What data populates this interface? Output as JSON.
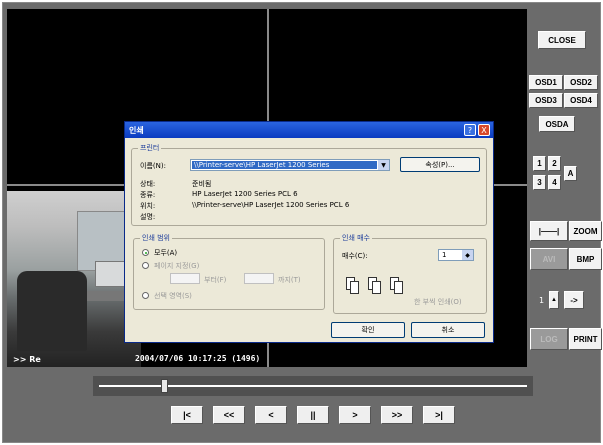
{
  "camera": {
    "caption": ">> Re",
    "timestamp": "2004/07/06 10:17:25 (1496)"
  },
  "side": {
    "close": "CLOSE",
    "osd1": "OSD1",
    "osd2": "OSD2",
    "osd3": "OSD3",
    "osd4": "OSD4",
    "osda": "OSDA",
    "grid1": "1",
    "grid2": "2",
    "grid3": "3",
    "grid4": "4",
    "gridA": "A",
    "zoom_slider": "|——|",
    "zoom": "ZOOM",
    "avi": "AVI",
    "bmp": "BMP",
    "step_label": "1",
    "step_arrow": "->",
    "log": "LOG",
    "print": "PRINT"
  },
  "dialog": {
    "title": "인쇄",
    "help": "?",
    "close": "X",
    "printer_group": "프린터",
    "name_label": "이름(N):",
    "name_value": "\\\\Printer-serve\\HP LaserJet 1200 Series",
    "properties_button": "속성(P)...",
    "status_label": "상태:",
    "status_value": "준비됨",
    "type_label": "종류:",
    "type_value": "HP LaserJet 1200 Series PCL 6",
    "where_label": "위치:",
    "where_value": "\\\\Printer-serve\\HP LaserJet 1200 Series PCL 6",
    "comment_label": "설명:",
    "range_group": "인쇄 범위",
    "all_label": "모두(A)",
    "pages_label": "페이지 지정(G)",
    "from_label": "부터(F)",
    "to_label": "까지(T)",
    "selection_label": "선택 영역(S)",
    "copies_group": "인쇄 매수",
    "copies_label": "매수(C):",
    "copies_value": "1",
    "collate_label": "한 부씩 인쇄(O)",
    "ok_button": "확인",
    "cancel_button": "취소"
  },
  "playback": {
    "first": "|<",
    "rewind": "<<",
    "back": "<",
    "pause": "||",
    "forward": ">",
    "fast_forward": ">>",
    "last": ">|"
  }
}
